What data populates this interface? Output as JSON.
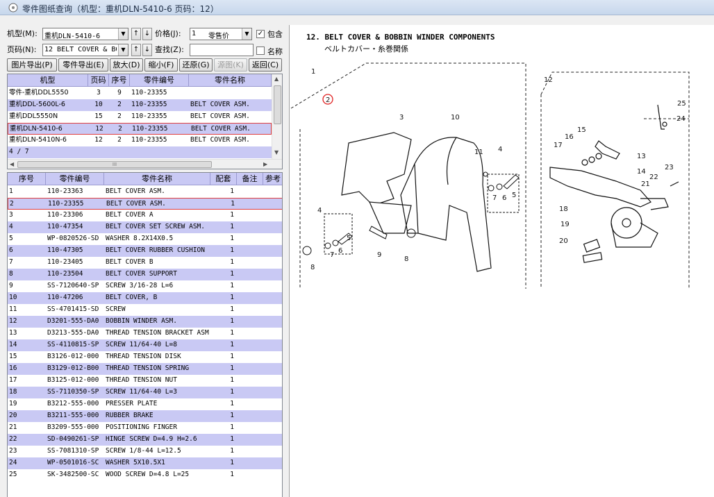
{
  "window": {
    "title": "零件图纸查询（机型：重机DLN-5410-6 页码：12）"
  },
  "filters": {
    "model_label": "机型(M):",
    "model_value": "重机DLN-5410-6",
    "price_label": "价格(J):",
    "price_value": "1",
    "price_type": "零售价",
    "include_label": "包含",
    "include_checked": "✓",
    "page_label": "页码(N):",
    "page_value": "12 BELT COVER & BOBBIN",
    "search_label": "查找(Z):",
    "search_value": "",
    "name_label": "名称",
    "up_arrow": "↑",
    "down_arrow": "↓"
  },
  "toolbar": {
    "export_image": "图片导出(P)",
    "export_parts": "零件导出(E)",
    "zoom_in": "放大(D)",
    "zoom_out": "缩小(F)",
    "restore": "还原(G)",
    "source_image": "源图(K)",
    "back": "返回(C)"
  },
  "model_grid": {
    "headers": [
      "机型",
      "页码",
      "序号",
      "零件编号",
      "零件名称"
    ],
    "rows": [
      {
        "model": "零件-重机DDL5550",
        "page": "3",
        "seq": "9",
        "part_no": "110-23355",
        "name": ""
      },
      {
        "model": "重机DDL-5600L-6",
        "page": "10",
        "seq": "2",
        "part_no": "110-23355",
        "name": "BELT COVER ASM."
      },
      {
        "model": "重机DDL5550N",
        "page": "15",
        "seq": "2",
        "part_no": "110-23355",
        "name": "BELT COVER ASM."
      },
      {
        "model": "重机DLN-5410-6",
        "page": "12",
        "seq": "2",
        "part_no": "110-23355",
        "name": "BELT COVER ASM."
      },
      {
        "model": "重机DLN-5410N-6",
        "page": "12",
        "seq": "2",
        "part_no": "110-23355",
        "name": "BELT COVER ASM."
      }
    ],
    "pager": "4 / 7",
    "hscroll_thumb": "III"
  },
  "parts_grid": {
    "headers": [
      "序号",
      "零件编号",
      "零件名称",
      "配套",
      "备注",
      "参考"
    ],
    "rows": [
      {
        "seq": "1",
        "part_no": "110-23363",
        "name": "BELT COVER ASM.",
        "qty": "1"
      },
      {
        "seq": "2",
        "part_no": "110-23355",
        "name": "BELT COVER ASM.",
        "qty": "1"
      },
      {
        "seq": "3",
        "part_no": "110-23306",
        "name": "BELT COVER A",
        "qty": "1"
      },
      {
        "seq": "4",
        "part_no": "110-47354",
        "name": "BELT COVER SET SCREW ASM.",
        "qty": "1"
      },
      {
        "seq": "5",
        "part_no": "WP-0820526-SD",
        "name": "WASHER 8.2X14X0.5",
        "qty": "1"
      },
      {
        "seq": "6",
        "part_no": "110-47305",
        "name": "BELT COVER RUBBER CUSHION",
        "qty": "1"
      },
      {
        "seq": "7",
        "part_no": "110-23405",
        "name": "BELT COVER B",
        "qty": "1"
      },
      {
        "seq": "8",
        "part_no": "110-23504",
        "name": "BELT COVER SUPPORT",
        "qty": "1"
      },
      {
        "seq": "9",
        "part_no": "SS-7120640-SP",
        "name": "SCREW 3/16-28 L=6",
        "qty": "1"
      },
      {
        "seq": "10",
        "part_no": "110-47206",
        "name": "BELT COVER, B",
        "qty": "1"
      },
      {
        "seq": "11",
        "part_no": "SS-4701415-SD",
        "name": "SCREW",
        "qty": "1"
      },
      {
        "seq": "12",
        "part_no": "D3201-555-DA0",
        "name": "BOBBIN WINDER ASM.",
        "qty": "1"
      },
      {
        "seq": "13",
        "part_no": "D3213-555-DA0",
        "name": "THREAD TENSION BRACKET ASM",
        "qty": "1"
      },
      {
        "seq": "14",
        "part_no": "SS-4110815-SP",
        "name": "SCREW 11/64-40 L=8",
        "qty": "1"
      },
      {
        "seq": "15",
        "part_no": "B3126-012-000",
        "name": "THREAD TENSION DISK",
        "qty": "1"
      },
      {
        "seq": "16",
        "part_no": "B3129-012-B00",
        "name": "THREAD TENSION SPRING",
        "qty": "1"
      },
      {
        "seq": "17",
        "part_no": "B3125-012-000",
        "name": "THREAD TENSION NUT",
        "qty": "1"
      },
      {
        "seq": "18",
        "part_no": "SS-7110350-SP",
        "name": "SCREW 11/64-40 L=3",
        "qty": "1"
      },
      {
        "seq": "19",
        "part_no": "B3212-555-000",
        "name": "PRESSER PLATE",
        "qty": "1"
      },
      {
        "seq": "20",
        "part_no": "B3211-555-000",
        "name": "RUBBER BRAKE",
        "qty": "1"
      },
      {
        "seq": "21",
        "part_no": "B3209-555-000",
        "name": "POSITIONING FINGER",
        "qty": "1"
      },
      {
        "seq": "22",
        "part_no": "SD-0490261-SP",
        "name": "HINGE SCREW  D=4.9 H=2.6",
        "qty": "1"
      },
      {
        "seq": "23",
        "part_no": "SS-7081310-SP",
        "name": "SCREW 1/8-44 L=12.5",
        "qty": "1"
      },
      {
        "seq": "24",
        "part_no": "WP-0501016-SC",
        "name": "WASHER  5X10.5X1",
        "qty": "1"
      },
      {
        "seq": "25",
        "part_no": "SK-3482500-SC",
        "name": "WOOD SCREW D=4.8 L=25",
        "qty": "1"
      }
    ]
  },
  "drawing": {
    "heading_en": "12. BELT COVER & BOBBIN WINDER COMPONENTS",
    "heading_jp": "ベルトカバー・糸巻関係",
    "callouts": [
      "1",
      "2",
      "3",
      "10",
      "11",
      "4",
      "6",
      "5",
      "7",
      "4",
      "6",
      "5",
      "9",
      "8",
      "8",
      "7",
      "12",
      "25",
      "24",
      "15",
      "16",
      "17",
      "13",
      "14",
      "23",
      "22",
      "21",
      "18",
      "19",
      "20"
    ]
  },
  "colors": {
    "row_alt": "#c9c9f4",
    "row_plain": "#ffffff",
    "selected_border": "#e04040",
    "header_bg": "#c9c9f4"
  }
}
